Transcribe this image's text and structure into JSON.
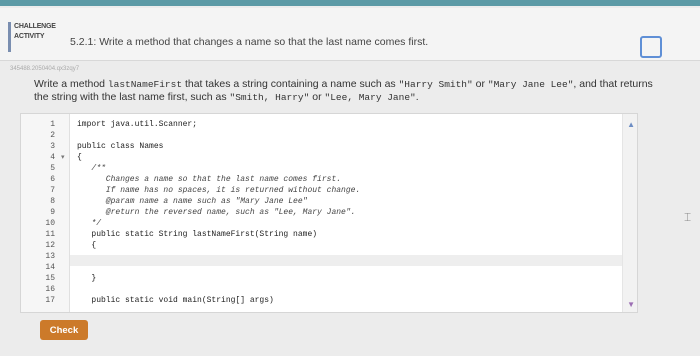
{
  "header": {
    "label_line1": "CHALLENGE",
    "label_line2": "ACTIVITY",
    "title": "5.2.1: Write a method that changes a name so that the last name comes first."
  },
  "activity_id": "345488.2050404.qx3zqy7",
  "description": {
    "prefix": "Write a method ",
    "method_name": "lastNameFirst",
    "mid1": " that takes a string containing a name such as ",
    "example1": "\"Harry Smith\"",
    "mid2": " or ",
    "example2": "\"Mary Jane Lee\"",
    "mid3": ", and that returns the string with the last name first, such as ",
    "result1": "\"Smith, Harry\"",
    "mid4": " or ",
    "result2": "\"Lee, Mary Jane\"",
    "suffix": "."
  },
  "editor": {
    "line_numbers": [
      "1",
      "2",
      "3",
      "4",
      "5",
      "6",
      "7",
      "8",
      "9",
      "10",
      "11",
      "12",
      "13",
      "14",
      "15",
      "16",
      "17"
    ],
    "lines": [
      "import java.util.Scanner;",
      "",
      "public class Names",
      "{",
      "   /**",
      "      Changes a name so that the last name comes first.",
      "      If name has no spaces, it is returned without change.",
      "      @param name a name such as \"Mary Jane Lee\"",
      "      @return the reversed name, such as \"Lee, Mary Jane\".",
      "   */",
      "   public static String lastNameFirst(String name)",
      "   {",
      "",
      "",
      "   }",
      "",
      "   public static void main(String[] args)"
    ]
  },
  "check_label": "Check"
}
